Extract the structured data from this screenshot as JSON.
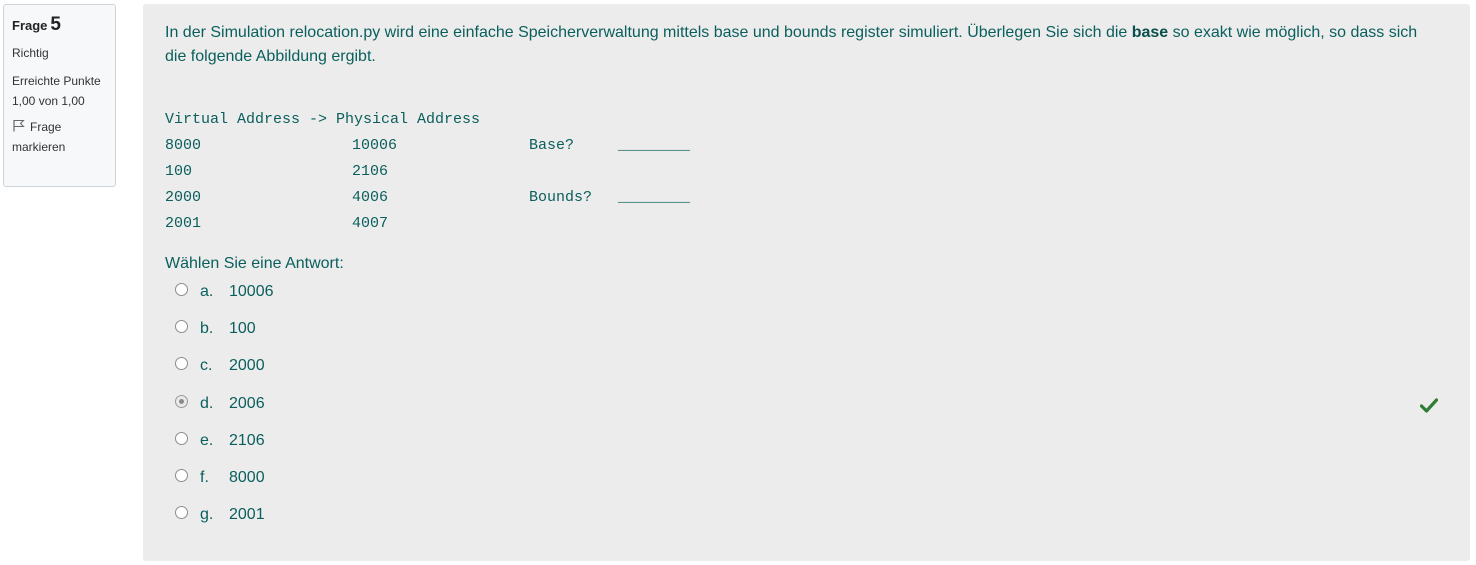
{
  "info": {
    "question_label": "Frage",
    "question_number": "5",
    "state": "Richtig",
    "grade": "Erreichte Punkte 1,00 von 1,00",
    "flag_label": "Frage markieren"
  },
  "question": {
    "text_before": "In der Simulation relocation.py wird eine einfache Speicherverwaltung mittels base und bounds register simuliert. Überlegen Sie sich die ",
    "text_bold": "base",
    "text_after": " so exakt wie möglich, so dass sich die folgende Abbildung ergibt.",
    "table": {
      "header": "Virtual Address -> Physical Address",
      "rows": [
        {
          "virtual": "8000",
          "physical": "10006",
          "label": "Base?",
          "blank": "________"
        },
        {
          "virtual": "100",
          "physical": "2106",
          "label": "",
          "blank": ""
        },
        {
          "virtual": "2000",
          "physical": "4006",
          "label": "Bounds?",
          "blank": "________"
        },
        {
          "virtual": "2001",
          "physical": "4007",
          "label": "",
          "blank": ""
        }
      ]
    },
    "prompt": "Wählen Sie eine Antwort:",
    "options": [
      {
        "letter": "a.",
        "value": "10006",
        "selected": false
      },
      {
        "letter": "b.",
        "value": "100",
        "selected": false
      },
      {
        "letter": "c.",
        "value": "2000",
        "selected": false
      },
      {
        "letter": "d.",
        "value": "2006",
        "selected": true
      },
      {
        "letter": "e.",
        "value": "2106",
        "selected": false
      },
      {
        "letter": "f.",
        "value": "8000",
        "selected": false
      },
      {
        "letter": "g.",
        "value": "2001",
        "selected": false
      }
    ]
  },
  "icons": {
    "flag": "flag-icon",
    "correct": "check-icon"
  },
  "colors": {
    "text_teal": "#0a5f5c",
    "panel_bg": "#ececec",
    "check_green": "#2e7d32"
  }
}
